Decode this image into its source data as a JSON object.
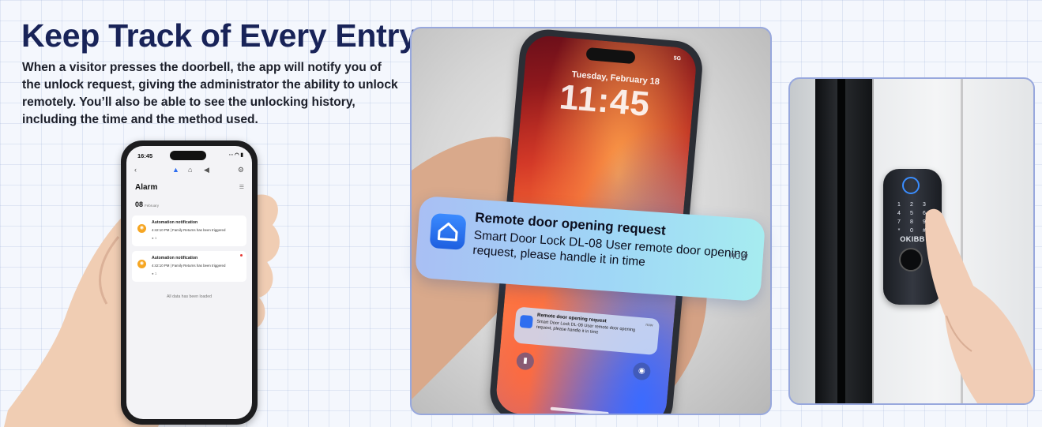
{
  "headline": "Keep Track of Every Entry",
  "intro": "When a visitor presses the doorbell, the app will notify you of the unlock request, giving the administrator the ability to unlock remotely. You’ll also be able to see the unlocking history, including the time and the method used.",
  "app_screen": {
    "status_time": "16:45",
    "status_icons": "∙∙∙ ◠ ▮",
    "back": "‹",
    "bell": "▲",
    "home": "⌂",
    "speaker": "◀",
    "settings": "⚙",
    "title": "Alarm",
    "filter": "☰",
    "date_day": "08",
    "date_month": "February",
    "cards": [
      {
        "title": "Automation notification",
        "detail": "4:42:10 PM | Family Returns has been triggered",
        "count": "1"
      },
      {
        "title": "Automation notification",
        "detail": "4:42:10 PM | Family Returns has been triggered",
        "count": "1"
      }
    ],
    "footer": "All data has been loaded"
  },
  "lockscreen": {
    "status": "5G",
    "date": "Tuesday, February 18",
    "time": "11:45",
    "mini_notification": {
      "title": "Remote door opening request",
      "body": "Smart Door Lock DL-08 User remote door opening request, please handle it in time",
      "when": "now"
    },
    "flashlight": "▮",
    "camera": "◉"
  },
  "notification": {
    "title": "Remote door opening request",
    "body": "Smart Door Lock DL-08 User remote door opening request, please handle it in time",
    "when": "now"
  },
  "lock": {
    "brand": "OKIBB",
    "keys": [
      "1",
      "2",
      "3",
      "4",
      "5",
      "6",
      "7",
      "8",
      "9",
      "*",
      "0",
      "#"
    ]
  },
  "colors": {
    "headline": "#182358",
    "accent": "#2e6ef0",
    "notification_bg": "#9fd6f6",
    "panel_border": "#98a8dd",
    "alarm_icon": "#f6a623"
  }
}
